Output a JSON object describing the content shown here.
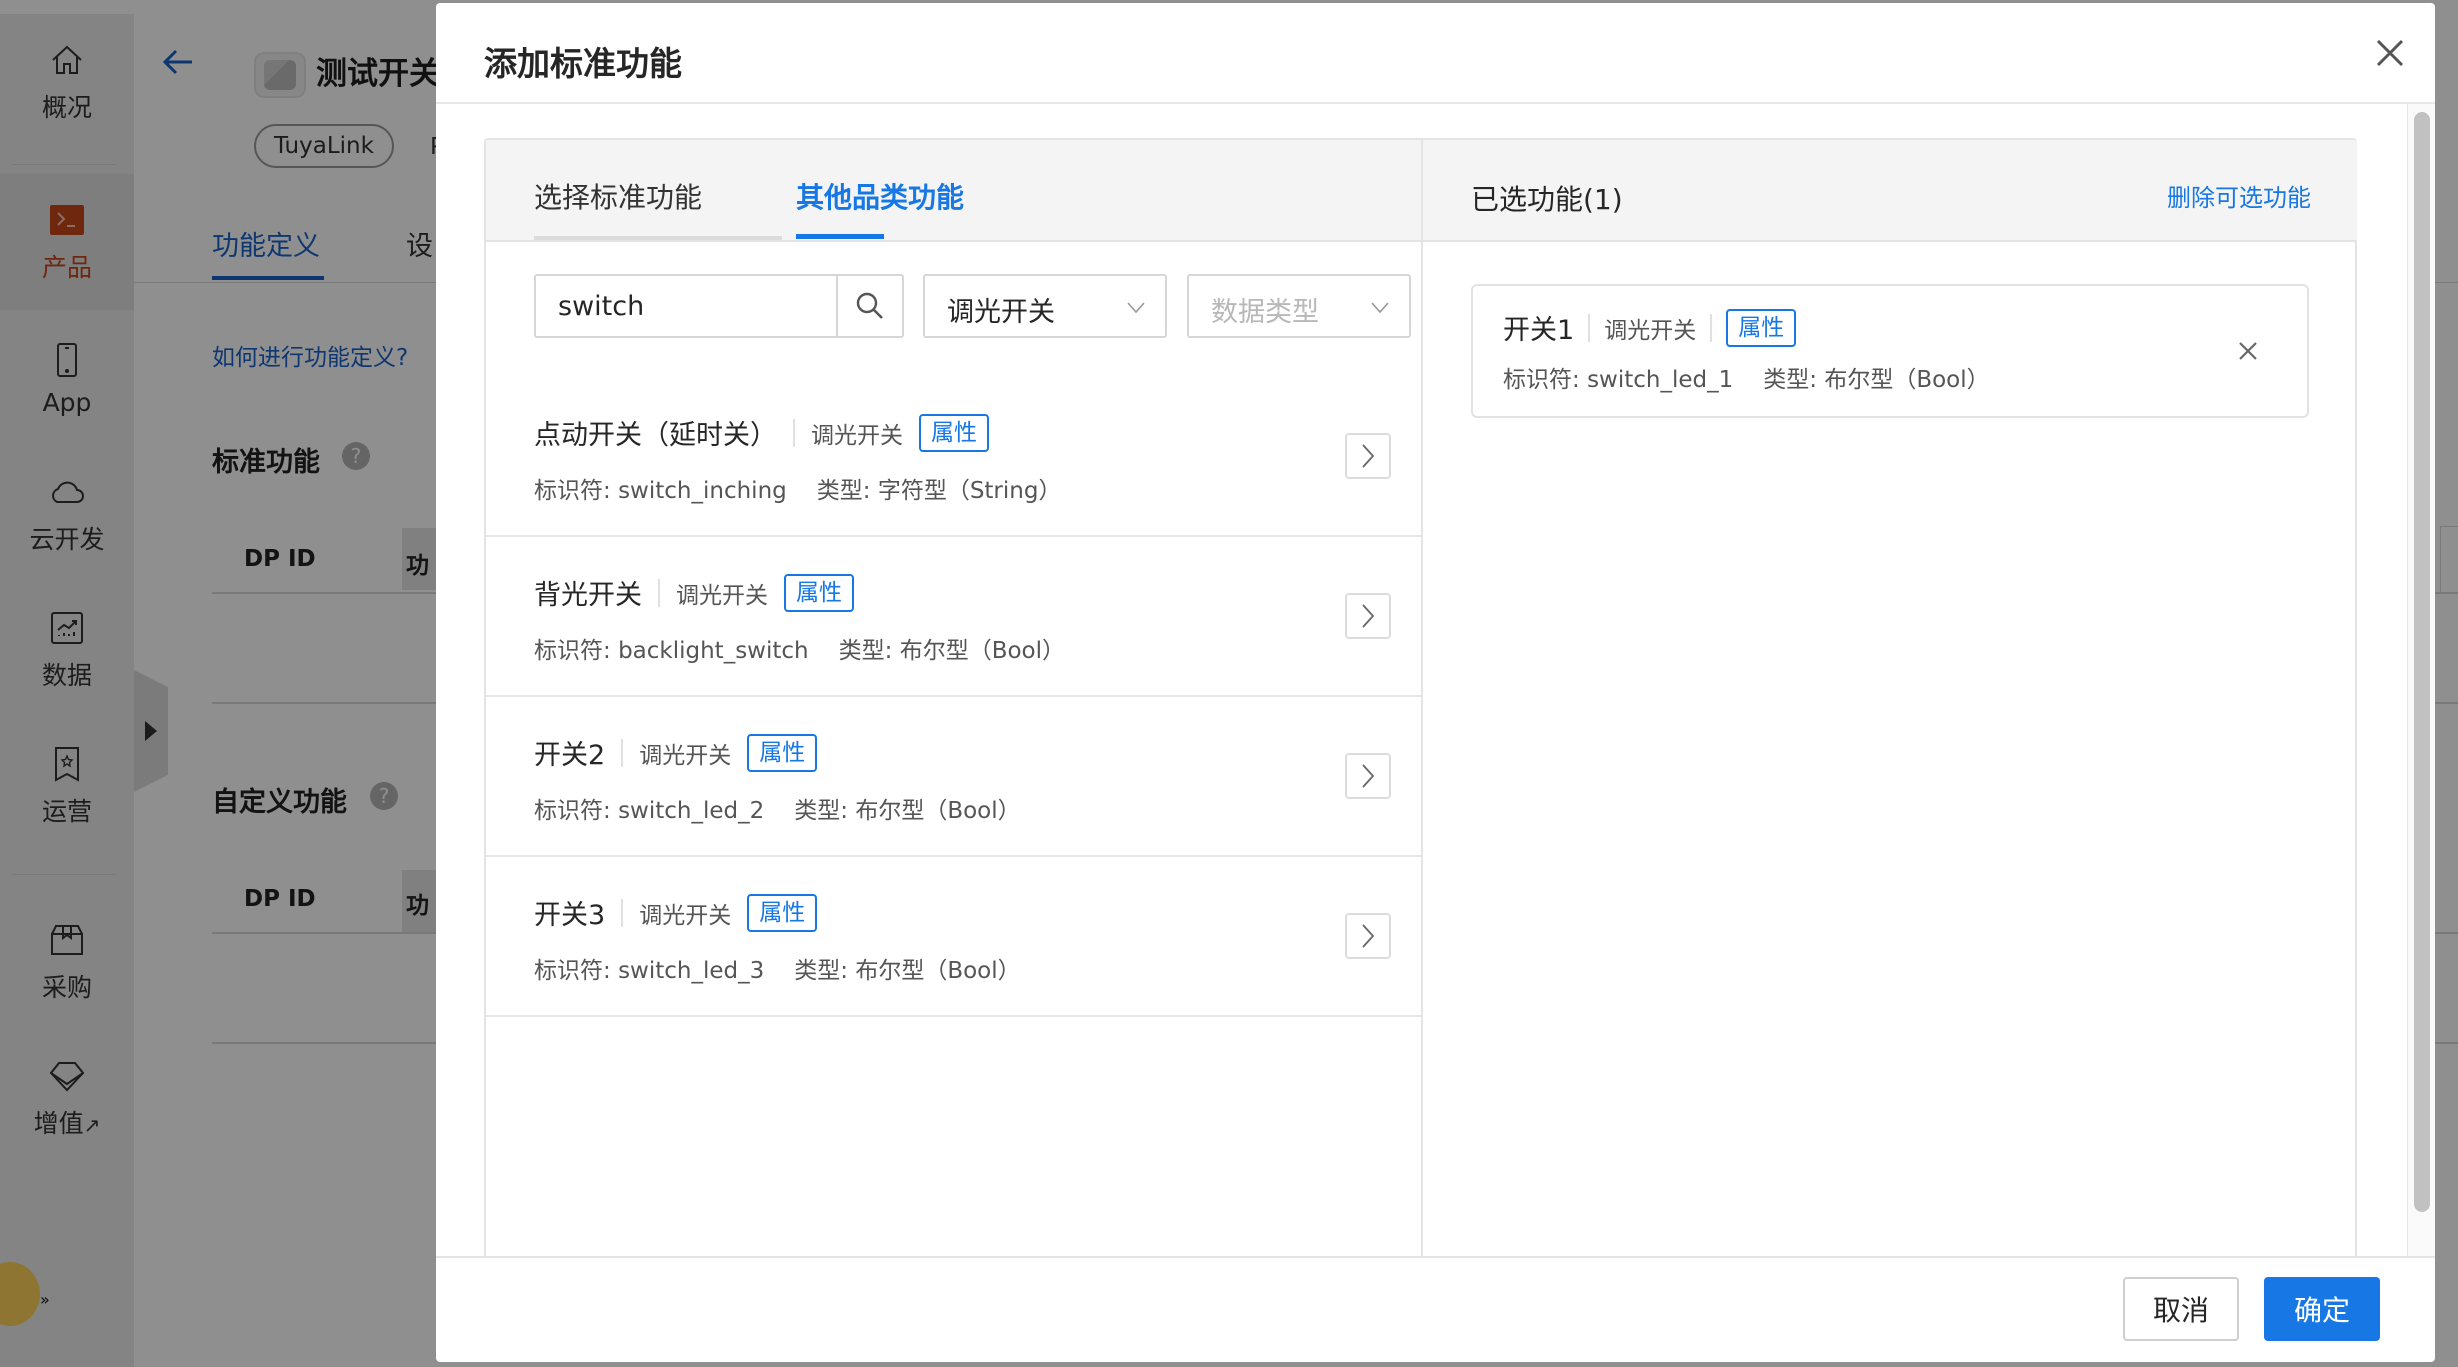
{
  "sidebar": {
    "items": [
      {
        "label": "概况",
        "icon": "home-icon",
        "active": false
      },
      {
        "label": "产品",
        "icon": "terminal-icon",
        "active": true
      },
      {
        "label": "App",
        "icon": "phone-icon",
        "active": false
      },
      {
        "label": "云开发",
        "icon": "cloud-icon",
        "active": false
      },
      {
        "label": "数据",
        "icon": "chart-icon",
        "active": false
      },
      {
        "label": "运营",
        "icon": "bookmark-star-icon",
        "active": false
      },
      {
        "label": "采购",
        "icon": "box-icon",
        "active": false
      },
      {
        "label": "增值",
        "icon": "diamond-icon",
        "active": false,
        "external": "↗"
      }
    ],
    "collapse_icon": "caret-right-icon"
  },
  "background": {
    "product_title": "测试开关",
    "protocol_pill": "TuyaLink",
    "protocol_next": "P",
    "tabs": [
      {
        "label": "功能定义",
        "active": true
      },
      {
        "label": "设",
        "active": false
      }
    ],
    "help_link": "如何进行功能定义?",
    "sections": [
      {
        "title": "标准功能",
        "help": "?",
        "col1": "DP ID",
        "col2": "功"
      },
      {
        "title": "自定义功能",
        "help": "?",
        "col1": "DP ID",
        "col2": "功"
      }
    ]
  },
  "modal": {
    "title": "添加标准功能",
    "close_icon": "close-icon",
    "tabs": [
      {
        "label": "选择标准功能",
        "active": false
      },
      {
        "label": "其他品类功能",
        "active": true
      }
    ],
    "search": {
      "value": "switch",
      "placeholder": ""
    },
    "category_select": {
      "value": "调光开关"
    },
    "datatype_select": {
      "placeholder": "数据类型"
    },
    "list": [
      {
        "name": "点动开关（延时关）",
        "category": "调光开关",
        "tag": "属性",
        "identifier_label": "标识符: ",
        "identifier": "switch_inching",
        "type_label": "类型: ",
        "type": "字符型（String）"
      },
      {
        "name": "背光开关",
        "category": "调光开关",
        "tag": "属性",
        "identifier_label": "标识符: ",
        "identifier": "backlight_switch",
        "type_label": "类型: ",
        "type": "布尔型（Bool）"
      },
      {
        "name": "开关2",
        "category": "调光开关",
        "tag": "属性",
        "identifier_label": "标识符: ",
        "identifier": "switch_led_2",
        "type_label": "类型: ",
        "type": "布尔型（Bool）"
      },
      {
        "name": "开关3",
        "category": "调光开关",
        "tag": "属性",
        "identifier_label": "标识符: ",
        "identifier": "switch_led_3",
        "type_label": "类型: ",
        "type": "布尔型（Bool）"
      }
    ],
    "selected": {
      "title": "已选功能(1)",
      "remove_optional_link": "删除可选功能",
      "items": [
        {
          "name": "开关1",
          "category": "调光开关",
          "tag": "属性",
          "identifier_label": "标识符: ",
          "identifier": "switch_led_1",
          "type_label": "类型: ",
          "type": "布尔型（Bool）"
        }
      ]
    },
    "footer": {
      "cancel_label": "取消",
      "ok_label": "确定"
    },
    "colors": {
      "primary": "#1677e5",
      "active_sidebar": "#c6461a"
    }
  }
}
